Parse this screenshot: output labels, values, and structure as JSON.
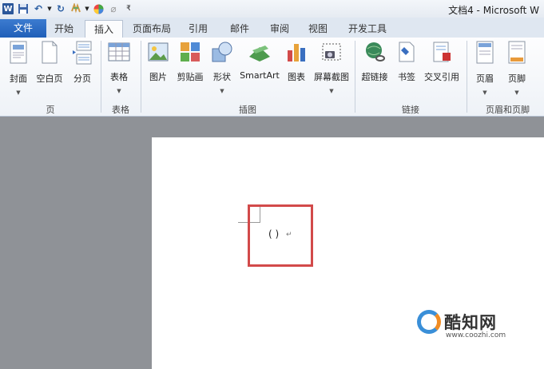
{
  "quick_access": {
    "app_icon": "word-app-icon",
    "items": [
      "save-icon",
      "undo-icon",
      "redo-icon",
      "format-painter-icon",
      "color-wheel-icon",
      "clear-format-icon",
      "customize-qat-icon"
    ]
  },
  "window": {
    "title": "文档4 - Microsoft W"
  },
  "tabs": [
    {
      "label": "文件"
    },
    {
      "label": "开始"
    },
    {
      "label": "插入"
    },
    {
      "label": "页面布局"
    },
    {
      "label": "引用"
    },
    {
      "label": "邮件"
    },
    {
      "label": "审阅"
    },
    {
      "label": "视图"
    },
    {
      "label": "开发工具"
    }
  ],
  "ribbon": {
    "buttons": [
      {
        "label": "封面",
        "icon": "cover-page-icon"
      },
      {
        "label": "空白页",
        "icon": "blank-page-icon"
      },
      {
        "label": "分页",
        "icon": "page-break-icon"
      },
      {
        "label": "表格",
        "icon": "table-icon"
      },
      {
        "label": "图片",
        "icon": "picture-icon"
      },
      {
        "label": "剪贴画",
        "icon": "clipart-icon"
      },
      {
        "label": "形状",
        "icon": "shapes-icon"
      },
      {
        "label": "SmartArt",
        "icon": "smartart-icon"
      },
      {
        "label": "图表",
        "icon": "chart-icon"
      },
      {
        "label": "屏幕截图",
        "icon": "screenshot-icon"
      },
      {
        "label": "超链接",
        "icon": "hyperlink-icon"
      },
      {
        "label": "书签",
        "icon": "bookmark-icon"
      },
      {
        "label": "交叉引用",
        "icon": "cross-reference-icon"
      },
      {
        "label": "页眉",
        "icon": "header-icon"
      },
      {
        "label": "页脚",
        "icon": "footer-icon"
      }
    ],
    "groups": [
      {
        "label": "页"
      },
      {
        "label": "表格"
      },
      {
        "label": "插图"
      },
      {
        "label": "链接"
      },
      {
        "label": "页眉和页脚"
      }
    ]
  },
  "document": {
    "content": "( )",
    "pilcrow": "↵"
  },
  "watermark": {
    "title": "酷知网",
    "url": "www.coozhi.com"
  },
  "colors": {
    "file_tab": "#1f5fb8",
    "highlight_box": "#d24a4a",
    "workspace": "#8f9297"
  }
}
